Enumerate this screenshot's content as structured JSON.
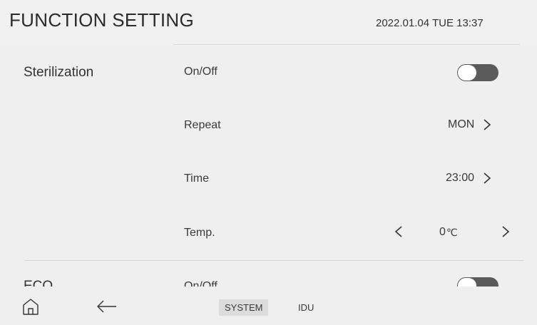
{
  "header": {
    "title": "FUNCTION SETTING",
    "datetime": "2022.01.04 TUE 13:37"
  },
  "sections": [
    {
      "label": "Sterilization",
      "rows": [
        {
          "label": "On/Off",
          "type": "toggle",
          "state": "off"
        },
        {
          "label": "Repeat",
          "type": "value",
          "value": "MON",
          "icon": "chevron-right-icon"
        },
        {
          "label": "Time",
          "type": "value",
          "value": "23:00",
          "icon": "chevron-right-icon"
        },
        {
          "label": "Temp.",
          "type": "stepper",
          "value": "0",
          "unit": "℃",
          "icons": [
            "chevron-left-icon",
            "chevron-right-icon"
          ]
        }
      ]
    },
    {
      "label": "ECO",
      "rows": [
        {
          "label": "On/Off",
          "type": "toggle",
          "state": "off"
        }
      ]
    }
  ],
  "footer": {
    "icons": [
      "home-icon",
      "back-arrow-icon"
    ],
    "tabs": [
      {
        "label": "SYSTEM",
        "active": true
      },
      {
        "label": "IDU",
        "active": false
      }
    ]
  },
  "colors": {
    "background": "#efefef",
    "toggle_track": "#5b5b5b",
    "toggle_knob": "#ffffff",
    "active_tab": "#dcdcdc"
  }
}
